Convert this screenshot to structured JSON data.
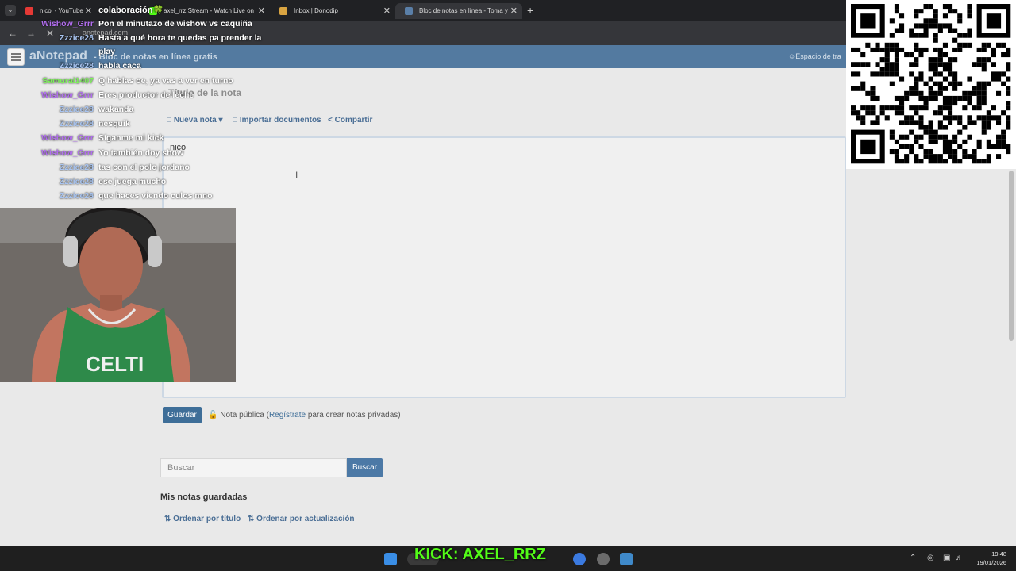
{
  "browser": {
    "tabs": [
      {
        "label": "nicol - YouTube",
        "fav": "#e53935"
      },
      {
        "label": "axel_rrz Stream - Watch Live on",
        "fav": "#53fc18"
      },
      {
        "label": "Inbox | Donodip",
        "fav": "#d9a441"
      },
      {
        "label": "Bloc de notas en línea - Toma y",
        "fav": "#5a7fa8"
      }
    ],
    "url": "anotepad.com",
    "stream_title": "colaboración🍀"
  },
  "site": {
    "logo": "aNotepad",
    "subtitle": "- Bloc de notas en línea gratis",
    "workspace": "Espacio de tra",
    "title_placeholder": "Título de la nota",
    "toolbar": {
      "new_note": "Nueva nota",
      "import": "Importar documentos",
      "share": "Compartir"
    },
    "note_text": "nico",
    "save_label": "Guardar",
    "public_prefix": "Nota pública (",
    "register_link": "Regístrate",
    "public_suffix": " para crear notas privadas)",
    "search_placeholder": "Buscar",
    "search_button": "Buscar",
    "saved_heading": "Mis notas guardadas",
    "sort_title": "Ordenar por título",
    "sort_update": "Ordenar por actualización"
  },
  "chat": [
    {
      "user": "Wishow_Grrr",
      "color": "#b26ef0",
      "msg": "Pon el minutazo de wishow vs caquiña"
    },
    {
      "user": "Zzzice28",
      "color": "#a8c4f0",
      "msg": "Hasta a qué hora te quedas pa prender la"
    },
    {
      "user": "",
      "color": "#a8c4f0",
      "msg": "play"
    },
    {
      "user": "Zzzice28",
      "color": "#a8c4f0",
      "msg": "habla caca"
    },
    {
      "user": "Samurai1407",
      "color": "#7df25a",
      "msg": "Q hablas oe, ya vas a ver en turno"
    },
    {
      "user": "Wishow_Grrr",
      "color": "#b26ef0",
      "msg": "Eres productor de leche"
    },
    {
      "user": "Zzzice28",
      "color": "#a8c4f0",
      "msg": "wakanda"
    },
    {
      "user": "Zzzice28",
      "color": "#a8c4f0",
      "msg": "nesquik"
    },
    {
      "user": "Wishow_Grrr",
      "color": "#b26ef0",
      "msg": "Síganme mi kick"
    },
    {
      "user": "Wishow_Grrr",
      "color": "#b26ef0",
      "msg": "Yo también doy show"
    },
    {
      "user": "Zzzice28",
      "color": "#a8c4f0",
      "msg": "tas con el polo jordano"
    },
    {
      "user": "Zzzice28",
      "color": "#a8c4f0",
      "msg": "ese juega mucho"
    },
    {
      "user": "Zzzice28",
      "color": "#a8c4f0",
      "msg": "que haces viendo culos mno"
    }
  ],
  "overlay": {
    "kick": "KICK: AXEL_RRZ"
  },
  "taskbar": {
    "time": "19:48",
    "date": "19/01/2026"
  }
}
